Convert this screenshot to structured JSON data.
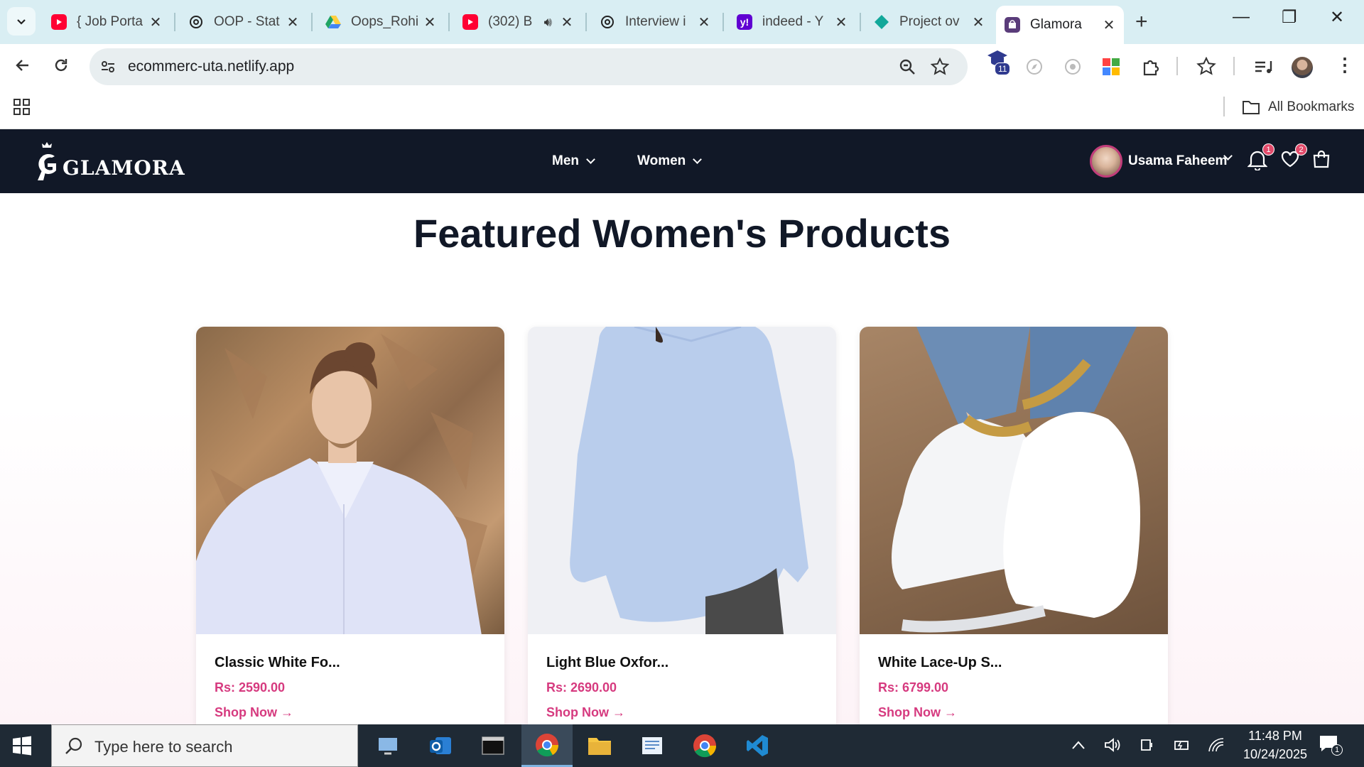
{
  "browser": {
    "tabs": [
      {
        "title": "{ Job Porta",
        "favicon": "youtube-icon",
        "color": "#ff0033"
      },
      {
        "title": "OOP - Stat",
        "favicon": "openai-icon",
        "color": "#222222"
      },
      {
        "title": "Oops_Rohi",
        "favicon": "google-drive-icon",
        "color": "#1fa463"
      },
      {
        "title": "(302) B",
        "favicon": "youtube-icon",
        "color": "#ff0033"
      },
      {
        "title": "Interview i",
        "favicon": "openai-icon",
        "color": "#222222"
      },
      {
        "title": "indeed - Y",
        "favicon": "yahoo-icon",
        "color": "#6001d2"
      },
      {
        "title": "Project ov",
        "favicon": "diamond-icon",
        "color": "#12a89a"
      },
      {
        "title": "Glamora",
        "favicon": "site-icon",
        "color": "#5a3c7a"
      }
    ],
    "url": "ecommerc-uta.netlify.app",
    "extension_badge": "11",
    "bookmarks_label": "All Bookmarks"
  },
  "site": {
    "logo_text": "GLAMORA",
    "nav": [
      "Men",
      "Women"
    ],
    "user_name": "Usama Faheem",
    "notifications_count": "1",
    "wishlist_count": "2"
  },
  "main": {
    "title": "Featured Women's Products",
    "products": [
      {
        "name": "Classic White Fo...",
        "price": "Rs: 2590.00",
        "cta": "Shop Now →"
      },
      {
        "name": "Light Blue Oxfor...",
        "price": "Rs: 2690.00",
        "cta": "Shop Now →"
      },
      {
        "name": "White Lace-Up S...",
        "price": "Rs: 6799.00",
        "cta": "Shop Now →"
      }
    ]
  },
  "taskbar": {
    "search_placeholder": "Type here to search",
    "time": "11:48 PM",
    "date": "10/24/2025",
    "notifications": "1"
  }
}
